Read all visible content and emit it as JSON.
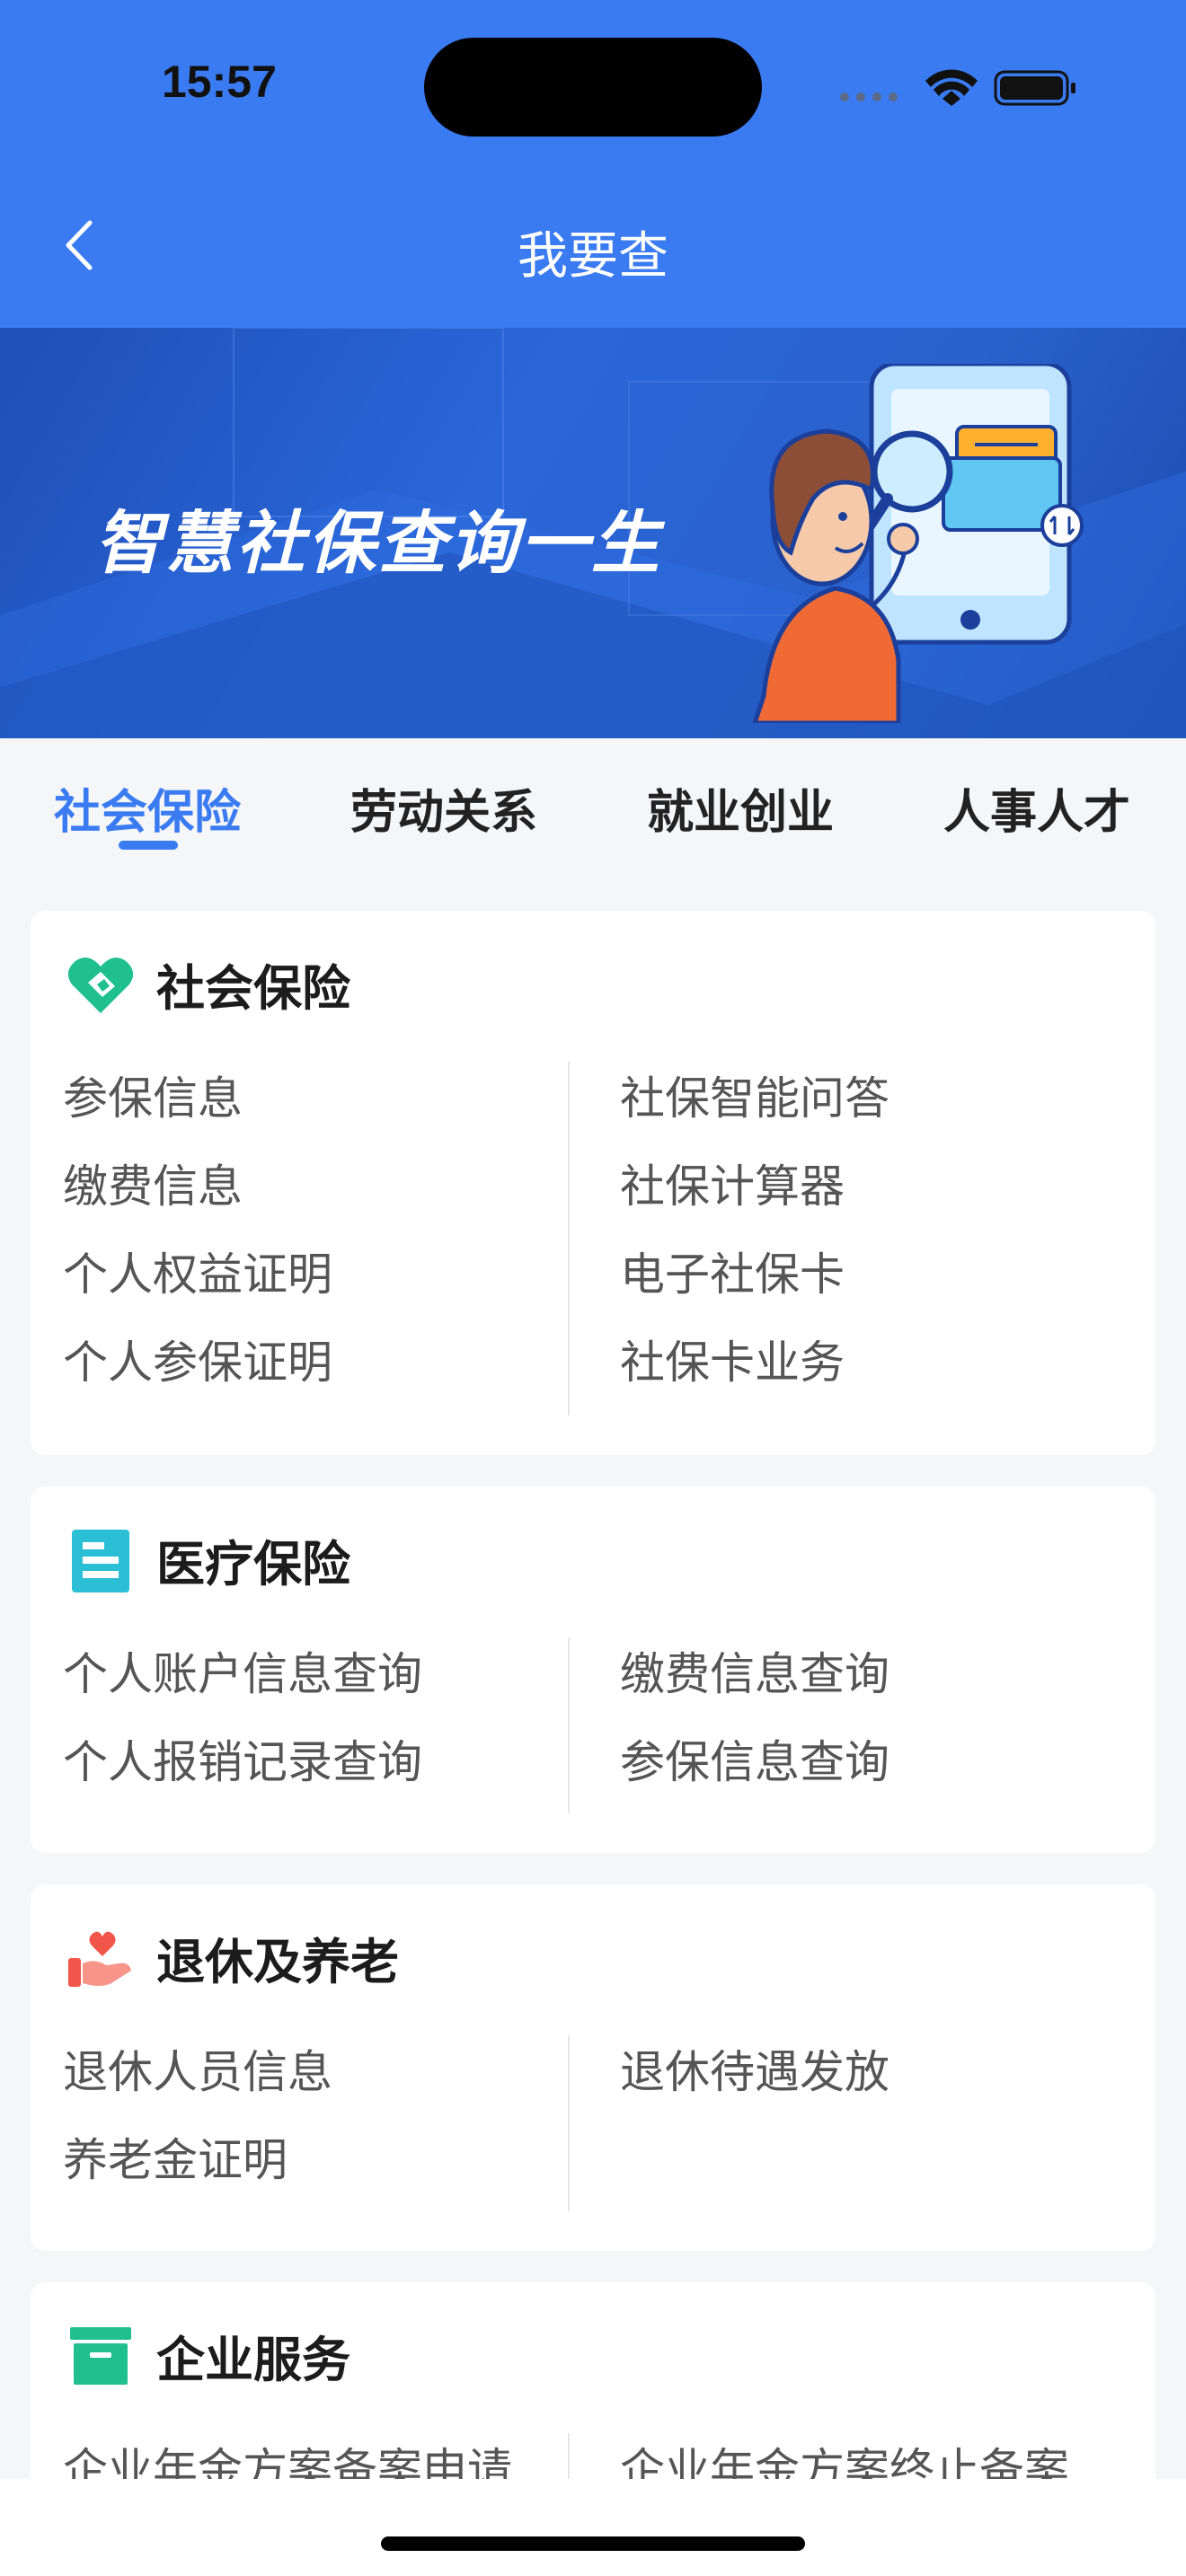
{
  "status_bar": {
    "time": "15:57"
  },
  "nav": {
    "title": "我要查"
  },
  "banner": {
    "headline": "智慧社保查询一生"
  },
  "tabs": [
    {
      "label": "社会保险",
      "active": true
    },
    {
      "label": "劳动关系",
      "active": false
    },
    {
      "label": "就业创业",
      "active": false
    },
    {
      "label": "人事人才",
      "active": false
    }
  ],
  "sections": [
    {
      "title": "社会保险",
      "icon": "social-insurance-icon",
      "left": [
        "参保信息",
        "缴费信息",
        "个人权益证明",
        "个人参保证明"
      ],
      "right": [
        "社保智能问答",
        "社保计算器",
        "电子社保卡",
        "社保卡业务"
      ]
    },
    {
      "title": "医疗保险",
      "icon": "medical-doc-icon",
      "left": [
        "个人账户信息查询",
        "个人报销记录查询"
      ],
      "right": [
        "缴费信息查询",
        "参保信息查询"
      ]
    },
    {
      "title": "退休及养老",
      "icon": "heart-hand-icon",
      "left": [
        "退休人员信息",
        "养老金证明"
      ],
      "right": [
        "退休待遇发放"
      ]
    },
    {
      "title": "企业服务",
      "icon": "archive-box-icon",
      "left": [
        "企业年金方案备案申请"
      ],
      "right": [
        "企业年金方案终止备案"
      ]
    }
  ],
  "colors": {
    "primary": "#3a7bf2",
    "green": "#1fc08e",
    "teal": "#2bbfd6",
    "red": "#f2564a"
  }
}
